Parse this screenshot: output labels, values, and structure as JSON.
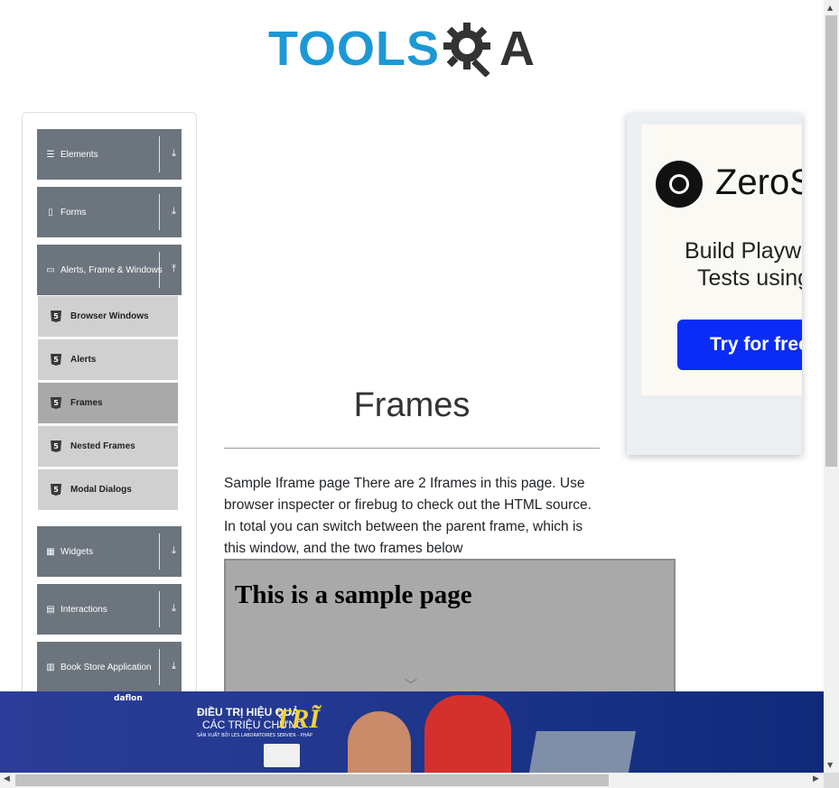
{
  "header": {
    "logo_text_left": "TOOLS",
    "logo_text_right": "A",
    "logo_gear_icon": "gear-magnifier-icon"
  },
  "sidebar": {
    "groups": [
      {
        "label": "Elements",
        "icon": "hamburger-icon",
        "arrow": "⤓"
      },
      {
        "label": "Forms",
        "icon": "form-icon",
        "arrow": "⤓"
      },
      {
        "label": "Alerts, Frame & Windows",
        "icon": "window-icon",
        "arrow": "⤒",
        "items": [
          {
            "label": "Browser Windows"
          },
          {
            "label": "Alerts"
          },
          {
            "label": "Frames"
          },
          {
            "label": "Nested Frames"
          },
          {
            "label": "Modal Dialogs"
          }
        ]
      },
      {
        "label": "Widgets",
        "icon": "grid-icon",
        "arrow": "⤓"
      },
      {
        "label": "Interactions",
        "icon": "interactions-icon",
        "arrow": "⤓"
      },
      {
        "label": "Book Store Application",
        "icon": "bookstore-icon",
        "arrow": "⤓"
      }
    ],
    "active_item": "Frames"
  },
  "main": {
    "title": "Frames",
    "description": "Sample Iframe page There are 2 Iframes in this page. Use browser inspecter or firebug to check out the HTML source. In total you can switch between the parent frame, which is this window, and the two frames below",
    "iframe_heading": "This is a sample page"
  },
  "ad_right": {
    "brand": "ZeroS",
    "line1": "Build Playwr",
    "line2": "Tests using",
    "button": "Try for free"
  },
  "banner": {
    "brand": "daflon",
    "line1": "ĐIỀU TRỊ HIỆU QUẢ",
    "line2": "CÁC TRIỆU CHỨNG",
    "line3": "TRĨ",
    "line4": "SẢN XUẤT BỞI LES LABORATOIRES SERVIER - PHÁP"
  },
  "colors": {
    "brand_blue": "#1d98d6",
    "group_header": "#6c757d",
    "sub_item": "#d0d0d0",
    "sub_item_active": "#a9a9a9",
    "iframe_bg": "#a9a9a9",
    "ad_button": "#0a2cf6"
  }
}
